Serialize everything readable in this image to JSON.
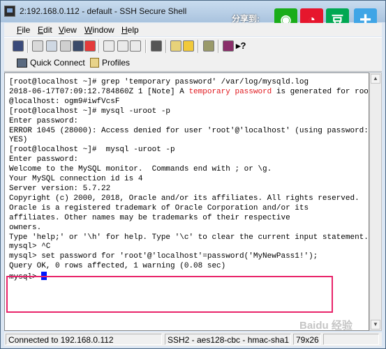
{
  "window": {
    "title": "2:192.168.0.112 - default - SSH Secure Shell"
  },
  "share": {
    "label": "分享到:",
    "buttons": [
      {
        "name": "wechat",
        "icon": "wechat-icon",
        "glyph": "◉",
        "color": "#1aad19"
      },
      {
        "name": "weibo",
        "icon": "weibo-icon",
        "glyph": "◔",
        "color": "#e6162d"
      },
      {
        "name": "douban",
        "icon": "douban-icon",
        "glyph": "豆",
        "color": "#00a852"
      },
      {
        "name": "more",
        "icon": "plus-icon",
        "glyph": "+",
        "color": "#3fa5e6"
      }
    ]
  },
  "menu": {
    "items": [
      {
        "key": "F",
        "rest": "ile"
      },
      {
        "key": "E",
        "rest": "dit"
      },
      {
        "key": "V",
        "rest": "iew"
      },
      {
        "key": "W",
        "rest": "indow"
      },
      {
        "key": "H",
        "rest": "elp"
      }
    ]
  },
  "toolbar": {
    "icons": [
      "save-icon",
      "print-icon",
      "print-preview-icon",
      "new-terminal-icon",
      "disconnect-icon",
      "cut-icon",
      "copy-icon",
      "paste-icon",
      "find-icon",
      "file-transfer-icon",
      "settings-icon",
      "key-icon",
      "help-icon"
    ]
  },
  "quickbar": {
    "quick_connect": "Quick Connect",
    "profiles": "Profiles"
  },
  "terminal": {
    "lines": [
      "[root@localhost ~]# grep 'temporary password' /var/log/mysqld.log",
      "2018-06-17T07:09:12.784860Z 1 [Note] A ",
      "@localhost: ogm9#iwfVcsF",
      "[root@localhost ~]# mysql -uroot -p",
      "Enter password:",
      "ERROR 1045 (28000): Access denied for user 'root'@'localhost' (using password:",
      "YES)",
      "[root@localhost ~]#  mysql -uroot -p",
      "Enter password:",
      "Welcome to the MySQL monitor.  Commands end with ; or \\g.",
      "Your MySQL connection id is 4",
      "Server version: 5.7.22",
      "",
      "Copyright (c) 2000, 2018, Oracle and/or its affiliates. All rights reserved.",
      "",
      "Oracle is a registered trademark of Oracle Corporation and/or its",
      "affiliates. Other names may be trademarks of their respective",
      "owners.",
      "",
      "Type 'help;' or '\\h' for help. Type '\\c' to clear the current input statement.",
      "",
      "mysql> ^C",
      "mysql> set password for 'root'@'localhost'=password('MyNewPass1!');",
      "Query OK, 0 rows affected, 1 warning (0.08 sec)",
      "",
      "mysql> "
    ],
    "highlight_word": "temporary password",
    "line2_tail": " is generated for root"
  },
  "status": {
    "connection": "Connected to 192.168.0.112",
    "cipher": "SSH2 - aes128-cbc - hmac-sha1",
    "size": "79x26"
  },
  "watermark": "Baidu 经验"
}
